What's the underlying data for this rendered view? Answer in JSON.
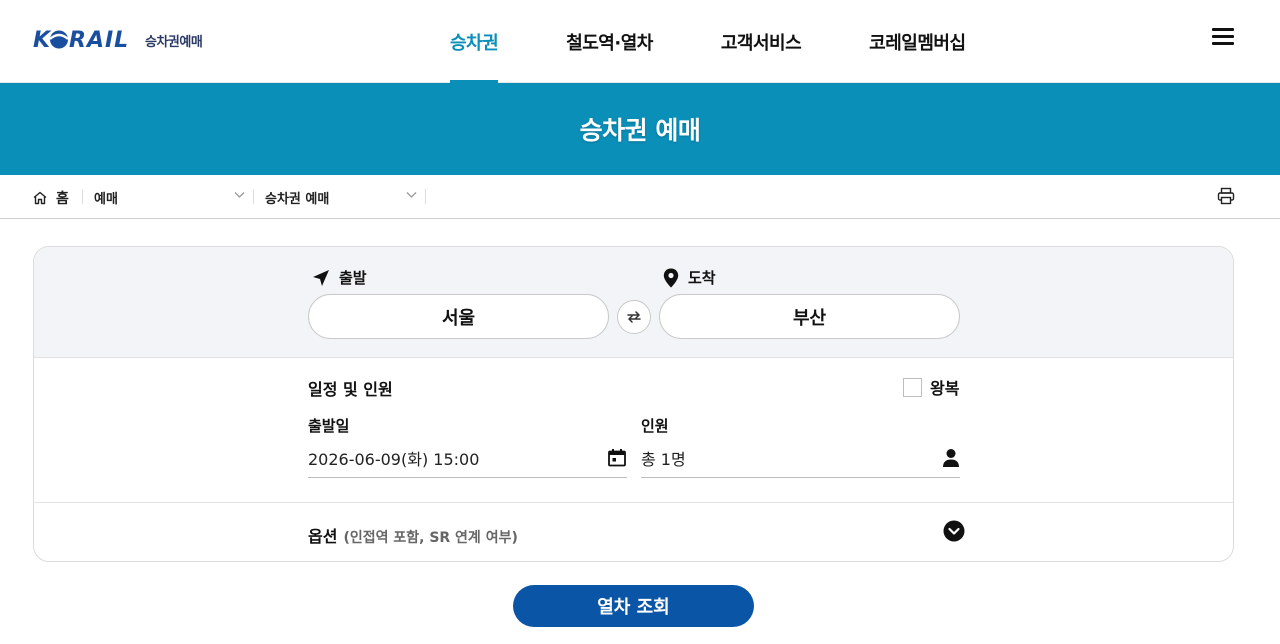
{
  "header": {
    "logo_text": "KORAIL",
    "logo_sub": "승차권예매",
    "nav": [
      {
        "label": "승차권",
        "active": true
      },
      {
        "label": "철도역·열차",
        "active": false
      },
      {
        "label": "고객서비스",
        "active": false
      },
      {
        "label": "코레일멤버십",
        "active": false
      }
    ],
    "menu_icon": "hamburger-icon"
  },
  "banner": {
    "title": "승차권 예매"
  },
  "breadcrumb": {
    "home": "홈",
    "level1": "예매",
    "level2": "승차권 예매",
    "print_icon": "printer-icon"
  },
  "route": {
    "departure_label": "출발",
    "departure_value": "서울",
    "arrival_label": "도착",
    "arrival_value": "부산",
    "swap_icon": "swap-arrows-icon"
  },
  "schedule": {
    "title": "일정 및 인원",
    "roundtrip_label": "왕복",
    "roundtrip_checked": false,
    "date_label": "출발일",
    "date_value": "2026-06-09(화) 15:00",
    "passengers_label": "인원",
    "passengers_value": "총 1명"
  },
  "options": {
    "title": "옵션",
    "subtitle": "(인접역 포함, SR 연계 여부)"
  },
  "search_button": "열차 조회",
  "colors": {
    "accent": "#0a8fb9",
    "primary_button": "#0b55a6",
    "route_bg": "#f3f4f7",
    "logo_blue": "#1a4fa0"
  }
}
